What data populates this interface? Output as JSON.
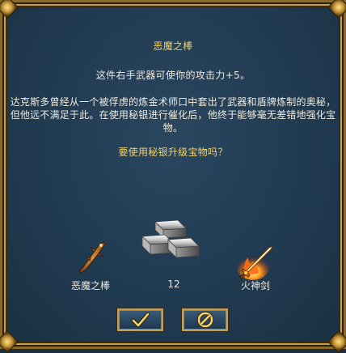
{
  "dialog": {
    "title": "恶魔之棒",
    "effect": "这件右手武器可使你的攻击力+5。",
    "description": "达克斯多曾经从一个被俘虏的炼金术师口中套出了武器和盾牌炼制的奥秘，但他远不满足于此。在使用秘银进行催化后，他终于能够毫无差错地强化宝物。",
    "question": "要使用秘银升级宝物吗？"
  },
  "items": {
    "source_name": "恶魔之棒",
    "material_count": "12",
    "result_name": "火神剑"
  },
  "buttons": {
    "confirm_icon": "checkmark-icon",
    "cancel_icon": "prohibit-icon"
  },
  "colors": {
    "title": "#f3d36a",
    "text": "#f0eadc",
    "frame_gold": "#c9a04a",
    "background": "#203a50"
  }
}
